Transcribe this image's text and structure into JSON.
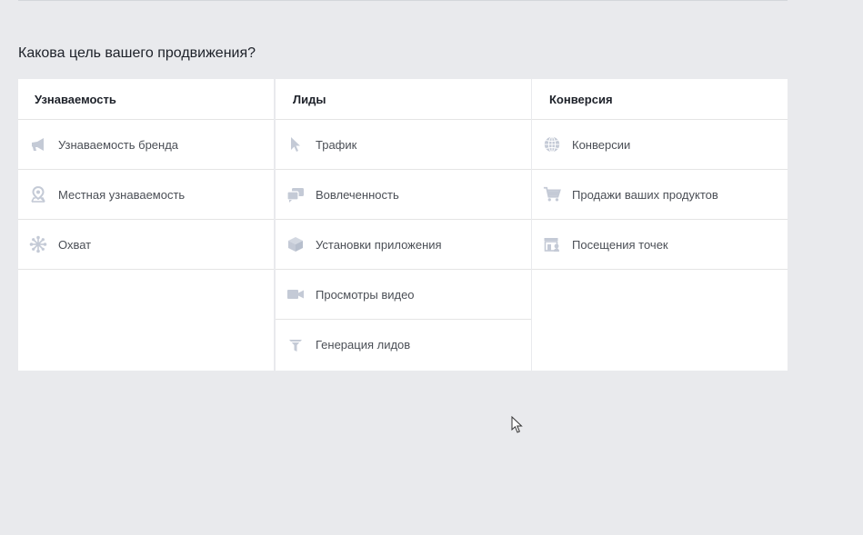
{
  "question": "Какова цель вашего продвижения?",
  "columns": [
    {
      "header": "Узнаваемость",
      "items": [
        {
          "label": "Узнаваемость бренда",
          "icon": "megaphone-icon"
        },
        {
          "label": "Местная узнаваемость",
          "icon": "location-pin-icon"
        },
        {
          "label": "Охват",
          "icon": "reach-icon"
        }
      ]
    },
    {
      "header": "Лиды",
      "items": [
        {
          "label": "Трафик",
          "icon": "cursor-arrow-icon"
        },
        {
          "label": "Вовлеченность",
          "icon": "chat-bubbles-icon"
        },
        {
          "label": "Установки приложения",
          "icon": "box-icon"
        },
        {
          "label": "Просмотры видео",
          "icon": "video-camera-icon"
        },
        {
          "label": "Генерация лидов",
          "icon": "funnel-icon"
        }
      ]
    },
    {
      "header": "Конверсия",
      "items": [
        {
          "label": "Конверсии",
          "icon": "globe-icon"
        },
        {
          "label": "Продажи ваших продуктов",
          "icon": "shopping-cart-icon"
        },
        {
          "label": "Посещения точек",
          "icon": "storefront-icon"
        }
      ]
    }
  ],
  "colors": {
    "background": "#e9eaed",
    "icon": "#c4cad6",
    "text": "#4b4f56"
  }
}
